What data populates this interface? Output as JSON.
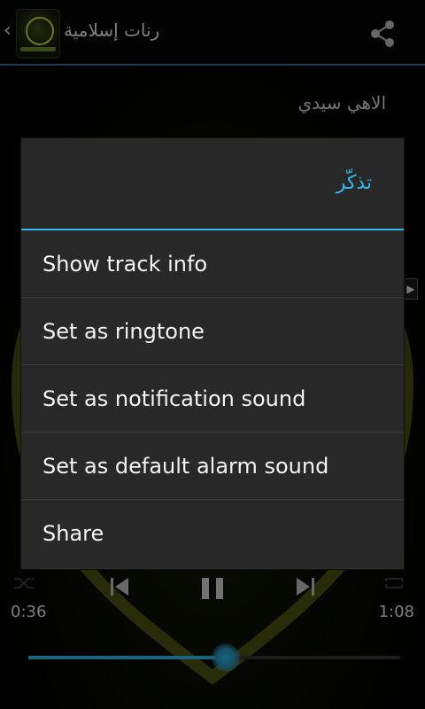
{
  "app_bar": {
    "title": "رنات إسلامية",
    "back_glyph": "‹",
    "share_icon": "share-icon"
  },
  "track": {
    "title": "الاهي سيدي"
  },
  "player": {
    "elapsed": "0:36",
    "total": "1:08",
    "progress": 0.53
  },
  "dialog": {
    "title": "تذكّر",
    "items": [
      "Show track info",
      "Set as ringtone",
      "Set as notification sound",
      "Set as default alarm sound",
      "Share"
    ]
  },
  "colors": {
    "accent": "#33b5e5",
    "dialog_bg": "#282828"
  }
}
